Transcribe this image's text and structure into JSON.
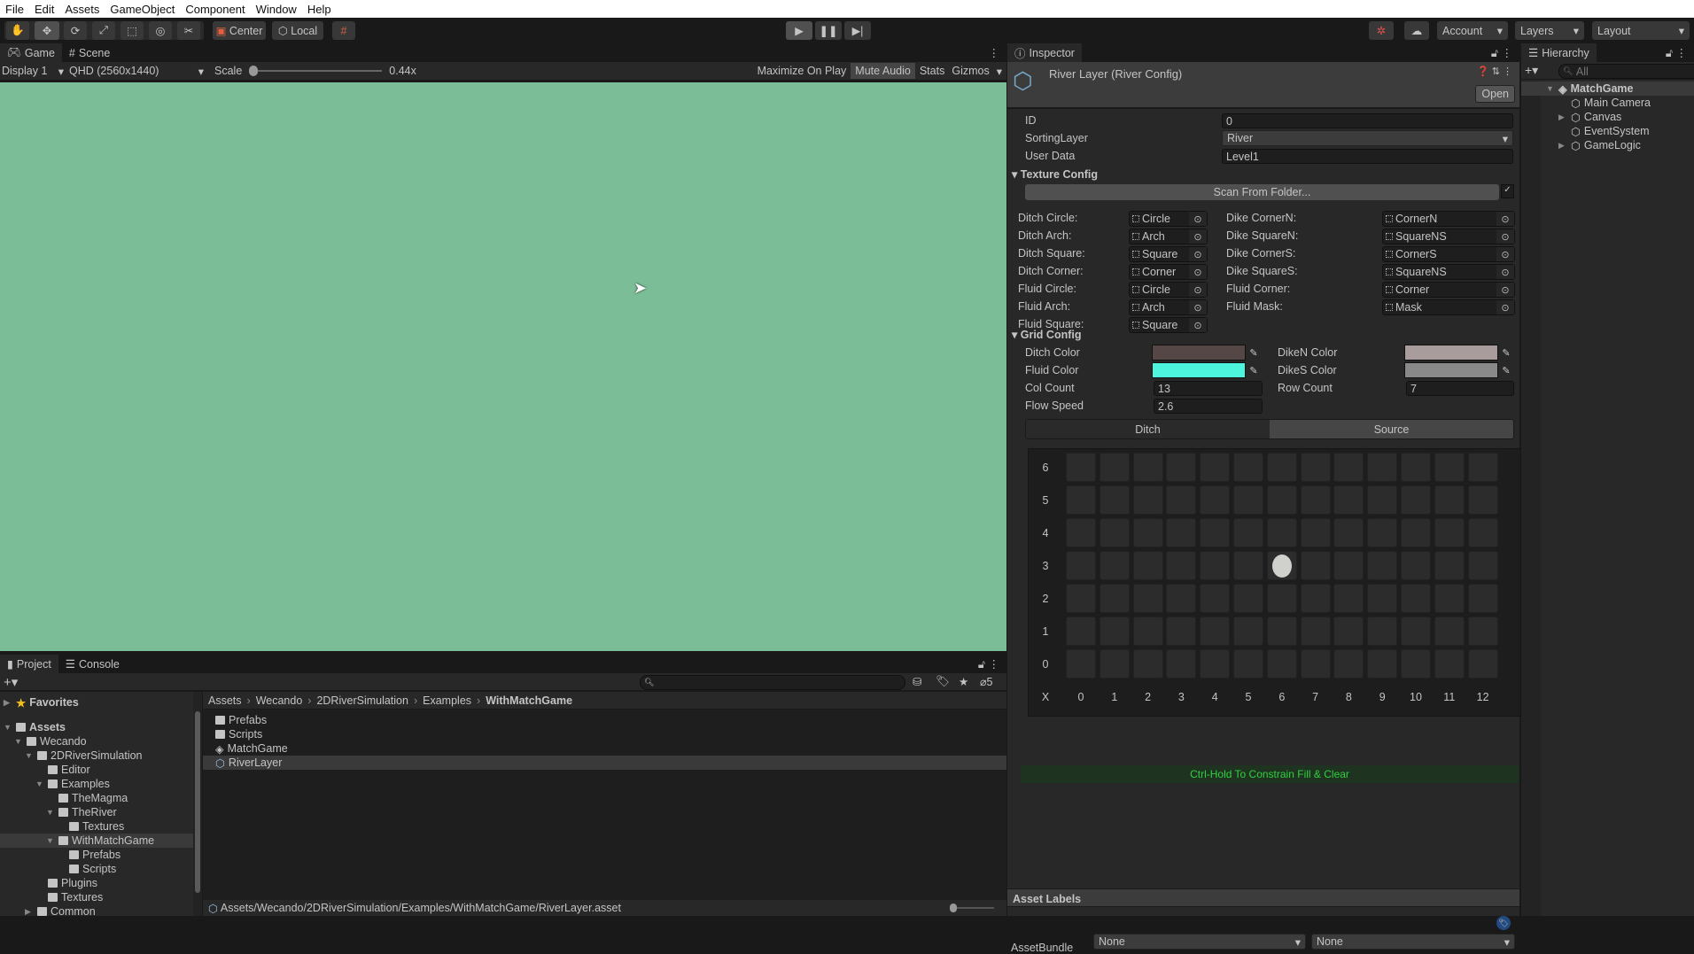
{
  "menu": [
    "File",
    "Edit",
    "Assets",
    "GameObject",
    "Component",
    "Window",
    "Help"
  ],
  "toolbar": {
    "tools": [
      "hand-tool",
      "move-tool",
      "rotate-tool",
      "scale-tool",
      "rect-tool",
      "transform-tool",
      "custom-tool"
    ],
    "pivot": "Center",
    "space": "Local",
    "account": "Account",
    "layers": "Layers",
    "layout": "Layout"
  },
  "game": {
    "tab_game": "Game",
    "tab_scene": "Scene",
    "display": "Display 1",
    "resolution": "QHD (2560x1440)",
    "scale_label": "Scale",
    "scale_value": "0.44x",
    "scale_fraction": 0,
    "maximize": "Maximize On Play",
    "mute": "Mute Audio",
    "stats": "Stats",
    "gizmos": "Gizmos",
    "background": "#7bbd96"
  },
  "inspector": {
    "tab": "Inspector",
    "title": "River Layer (River Config)",
    "open": "Open",
    "fields": [
      {
        "label": "ID",
        "value": "0"
      },
      {
        "label": "SortingLayer",
        "value": "River"
      },
      {
        "label": "User Data",
        "value": "Level1"
      }
    ],
    "texture_config": "Texture Config",
    "scan": "Scan From Folder...",
    "left_tex": [
      {
        "label": "Ditch Circle:",
        "value": "Circle"
      },
      {
        "label": "Ditch Arch:",
        "value": "Arch"
      },
      {
        "label": "Ditch Square:",
        "value": "Square"
      },
      {
        "label": "Ditch Corner:",
        "value": "Corner"
      },
      {
        "label": "Fluid Circle:",
        "value": "Circle"
      },
      {
        "label": "Fluid Arch:",
        "value": "Arch"
      },
      {
        "label": "Fluid Square:",
        "value": "Square"
      }
    ],
    "right_tex": [
      {
        "label": "Dike CornerN:",
        "value": "CornerN"
      },
      {
        "label": "Dike SquareN:",
        "value": "SquareNS"
      },
      {
        "label": "Dike CornerS:",
        "value": "CornerS"
      },
      {
        "label": "Dike SquareS:",
        "value": "SquareNS"
      },
      {
        "label": "Fluid Corner:",
        "value": "Corner"
      },
      {
        "label": "Fluid Mask:",
        "value": "Mask"
      }
    ],
    "grid_config": "Grid Config",
    "ditch_color": {
      "label": "Ditch Color",
      "color": "#544746"
    },
    "fluid_color": {
      "label": "Fluid Color",
      "color": "#4cf5dc"
    },
    "diken_color": {
      "label": "DikeN Color",
      "color": "#a89c9c"
    },
    "dikes_color": {
      "label": "DikeS Color",
      "color": "#898989"
    },
    "col_count": {
      "label": "Col Count",
      "value": "13"
    },
    "row_count": {
      "label": "Row Count",
      "value": "7"
    },
    "flow_speed": {
      "label": "Flow Speed",
      "value": "2.6"
    },
    "tabs": [
      "Ditch",
      "Source"
    ],
    "active_tab": "Source",
    "grid": {
      "rows": [
        "6",
        "5",
        "4",
        "3",
        "2",
        "1",
        "0"
      ],
      "x_label": "X",
      "cols": [
        "0",
        "1",
        "2",
        "3",
        "4",
        "5",
        "6",
        "7",
        "8",
        "9",
        "10",
        "11",
        "12"
      ],
      "sources": [
        [
          6,
          3
        ]
      ]
    },
    "hint": "Ctrl-Hold To Constrain Fill & Clear",
    "asset_labels": "Asset Labels",
    "assetbundle_label": "AssetBundle",
    "assetbundle": "None",
    "variant": "None"
  },
  "hierarchy": {
    "tab": "Hierarchy",
    "search_placeholder": "All",
    "items": [
      {
        "label": "MatchGame",
        "depth": 0,
        "arrow": "open"
      },
      {
        "label": "Main Camera",
        "depth": 1
      },
      {
        "label": "Canvas",
        "depth": 1,
        "arrow": "closed"
      },
      {
        "label": "EventSystem",
        "depth": 1
      },
      {
        "label": "GameLogic",
        "depth": 1,
        "arrow": "closed"
      }
    ]
  },
  "project": {
    "tab_project": "Project",
    "tab_console": "Console",
    "hidden_count": "5",
    "tree": [
      {
        "label": "Favorites",
        "depth": 0,
        "arrow": "closed",
        "bold": true
      },
      {
        "label": "Assets",
        "depth": 0,
        "arrow": "open",
        "bold": true
      },
      {
        "label": "Wecando",
        "depth": 1,
        "arrow": "open"
      },
      {
        "label": "2DRiverSimulation",
        "depth": 2,
        "arrow": "open"
      },
      {
        "label": "Editor",
        "depth": 3
      },
      {
        "label": "Examples",
        "depth": 3,
        "arrow": "open"
      },
      {
        "label": "TheMagma",
        "depth": 4
      },
      {
        "label": "TheRiver",
        "depth": 4,
        "arrow": "open"
      },
      {
        "label": "Textures",
        "depth": 5
      },
      {
        "label": "WithMatchGame",
        "depth": 4,
        "arrow": "open",
        "selected": true
      },
      {
        "label": "Prefabs",
        "depth": 5
      },
      {
        "label": "Scripts",
        "depth": 5
      },
      {
        "label": "Plugins",
        "depth": 3
      },
      {
        "label": "Textures",
        "depth": 3
      },
      {
        "label": "Common",
        "depth": 2,
        "arrow": "closed"
      }
    ],
    "breadcrumb": [
      "Assets",
      "Wecando",
      "2DRiverSimulation",
      "Examples",
      "WithMatchGame"
    ],
    "files": [
      {
        "label": "Prefabs",
        "type": "folder"
      },
      {
        "label": "Scripts",
        "type": "folder"
      },
      {
        "label": "MatchGame",
        "type": "scene"
      },
      {
        "label": "RiverLayer",
        "type": "asset",
        "selected": true
      }
    ],
    "path": "Assets/Wecando/2DRiverSimulation/Examples/WithMatchGame/RiverLayer.asset"
  }
}
